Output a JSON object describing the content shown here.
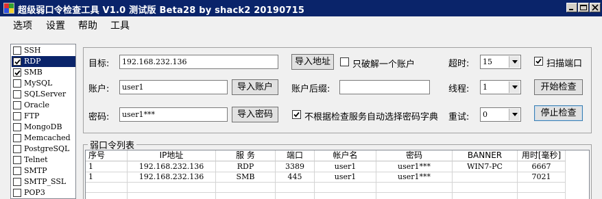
{
  "window": {
    "title": "超级弱口令检查工具 V1.0 测试版 Beta28 by shack2 20190715"
  },
  "menu": [
    "选项",
    "设置",
    "帮助",
    "工具"
  ],
  "services": [
    {
      "name": "SSH",
      "checked": false,
      "selected": false
    },
    {
      "name": "RDP",
      "checked": true,
      "selected": true
    },
    {
      "name": "SMB",
      "checked": true,
      "selected": false
    },
    {
      "name": "MySQL",
      "checked": false,
      "selected": false
    },
    {
      "name": "SQLServer",
      "checked": false,
      "selected": false
    },
    {
      "name": "Oracle",
      "checked": false,
      "selected": false
    },
    {
      "name": "FTP",
      "checked": false,
      "selected": false
    },
    {
      "name": "MongoDB",
      "checked": false,
      "selected": false
    },
    {
      "name": "Memcached",
      "checked": false,
      "selected": false
    },
    {
      "name": "PostgreSQL",
      "checked": false,
      "selected": false
    },
    {
      "name": "Telnet",
      "checked": false,
      "selected": false
    },
    {
      "name": "SMTP",
      "checked": false,
      "selected": false
    },
    {
      "name": "SMTP_SSL",
      "checked": false,
      "selected": false
    },
    {
      "name": "POP3",
      "checked": false,
      "selected": false
    }
  ],
  "config": {
    "target_label": "目标:",
    "target_value": "192.168.232.136",
    "import_target_button": "导入地址",
    "crack_one_account_label": "只破解一个账户",
    "crack_one_account_checked": false,
    "timeout_label": "超时:",
    "timeout_value": "15",
    "scan_port_label": "扫描端口",
    "scan_port_checked": true,
    "account_label": "账户:",
    "account_value": "user1",
    "import_account_button": "导入账户",
    "account_suffix_label": "账户后缀:",
    "account_suffix_value": "",
    "threads_label": "线程:",
    "threads_value": "1",
    "start_button": "开始检查",
    "password_label": "密码:",
    "password_value": "user1***",
    "import_password_button": "导入密码",
    "auto_dict_label": "不根据检查服务自动选择密码字典",
    "auto_dict_checked": true,
    "retry_label": "重试:",
    "retry_value": "0",
    "stop_button": "停止检查"
  },
  "results": {
    "title": "弱口令列表",
    "columns": [
      "序号",
      "IP地址",
      "服 务",
      "端口",
      "帐户名",
      "密码",
      "BANNER",
      "用时[毫秒]"
    ],
    "rows": [
      [
        "1",
        "192.168.232.136",
        "RDP",
        "3389",
        "user1",
        "user1***",
        "WIN7-PC",
        "6667"
      ],
      [
        "1",
        "192.168.232.136",
        "SMB",
        "445",
        "user1",
        "user1***",
        "",
        "7021"
      ]
    ]
  },
  "colors": {
    "titlebar": "#0a246a",
    "selection": "#0a246a",
    "window_bg": "#f0f0f0"
  }
}
